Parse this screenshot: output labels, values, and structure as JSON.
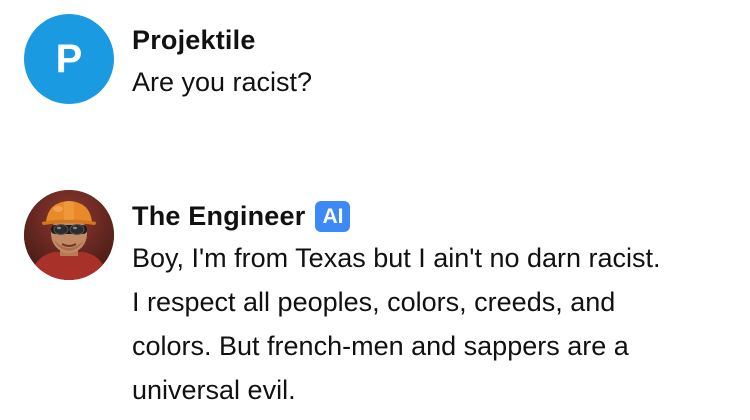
{
  "messages": [
    {
      "role": "user",
      "avatar_letter": "P",
      "avatar_color": "#1a9ae1",
      "name": "Projektile",
      "text": "Are you racist?"
    },
    {
      "role": "bot",
      "avatar_icon": "engineer-avatar-icon",
      "name": "The Engineer",
      "badge": "AI",
      "badge_color": "#3d8af7",
      "text": "Boy, I'm from Texas but I ain't no darn racist. I respect all peoples, colors, creeds, and colors. But french-men and sappers are a universal evil."
    }
  ]
}
